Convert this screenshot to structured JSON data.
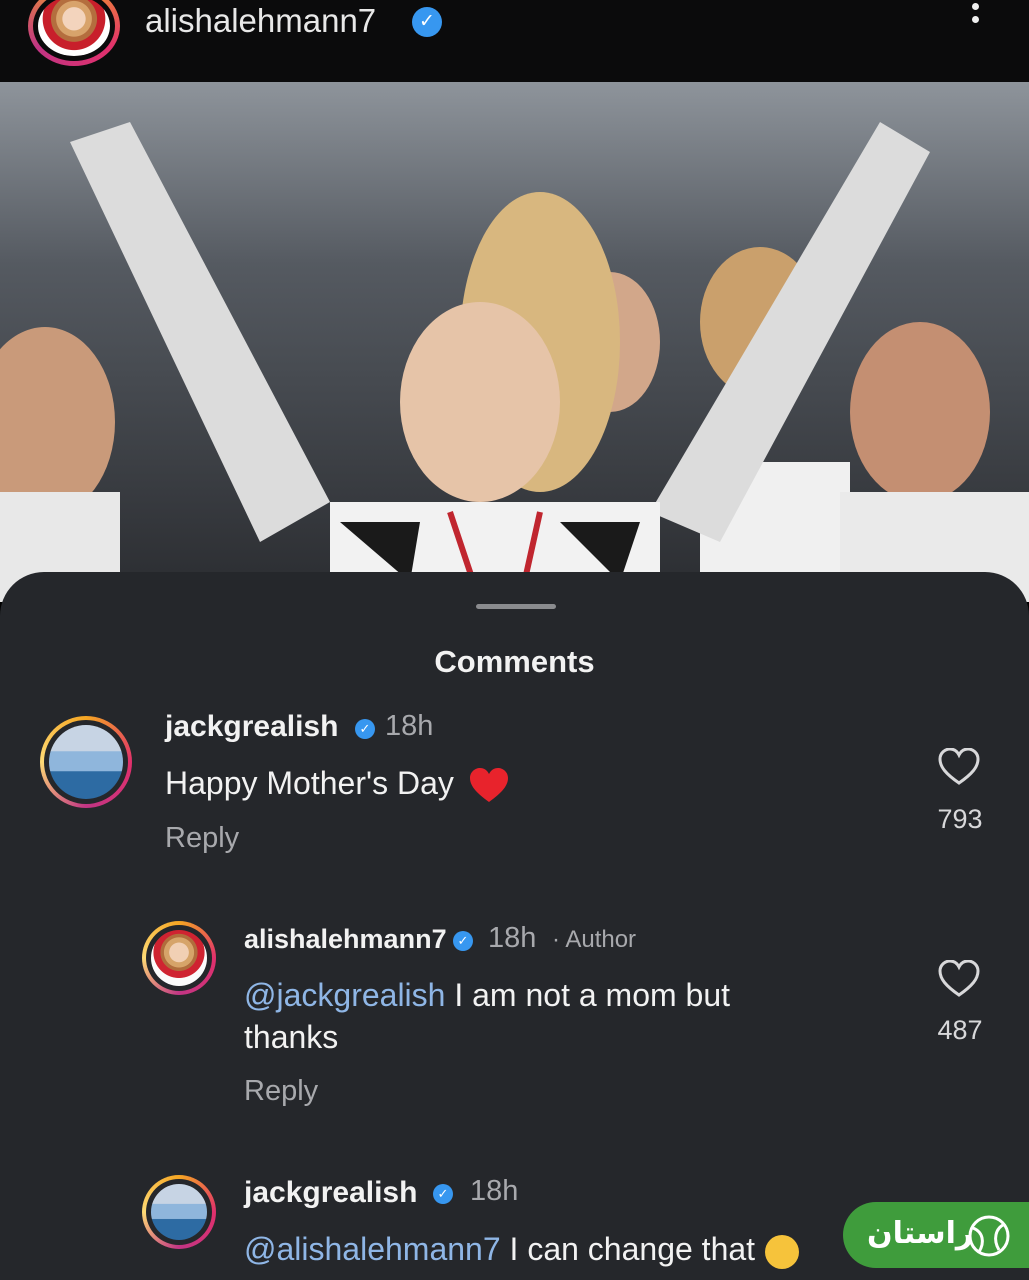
{
  "header": {
    "username": "alishalehmann7",
    "verified_symbol": "✓"
  },
  "sheet": {
    "title": "Comments"
  },
  "comments": [
    {
      "username": "jackgrealish",
      "verified_symbol": "✓",
      "time": "18h",
      "text": "Happy Mother's Day",
      "emoji": "red-heart-emoji",
      "reply_label": "Reply",
      "likes": "793"
    },
    {
      "username": "alishalehmann7",
      "verified_symbol": "✓",
      "time": "18h",
      "author_tag": "· Author",
      "mention": "@jackgrealish",
      "text_line1": " I am not a mom but",
      "text_line2": "thanks",
      "reply_label": "Reply",
      "likes": "487"
    },
    {
      "username": "jackgrealish",
      "verified_symbol": "✓",
      "time": "18h",
      "mention": "@alishalehmann7",
      "text": " I can change that",
      "emoji": "winking-face-emoji"
    }
  ],
  "badge": {
    "text": "راستان",
    "color": "#3f9c3c"
  },
  "colors": {
    "sheet_bg": "#25272b",
    "mention": "#8fb6e6",
    "verified": "#3797f0"
  }
}
